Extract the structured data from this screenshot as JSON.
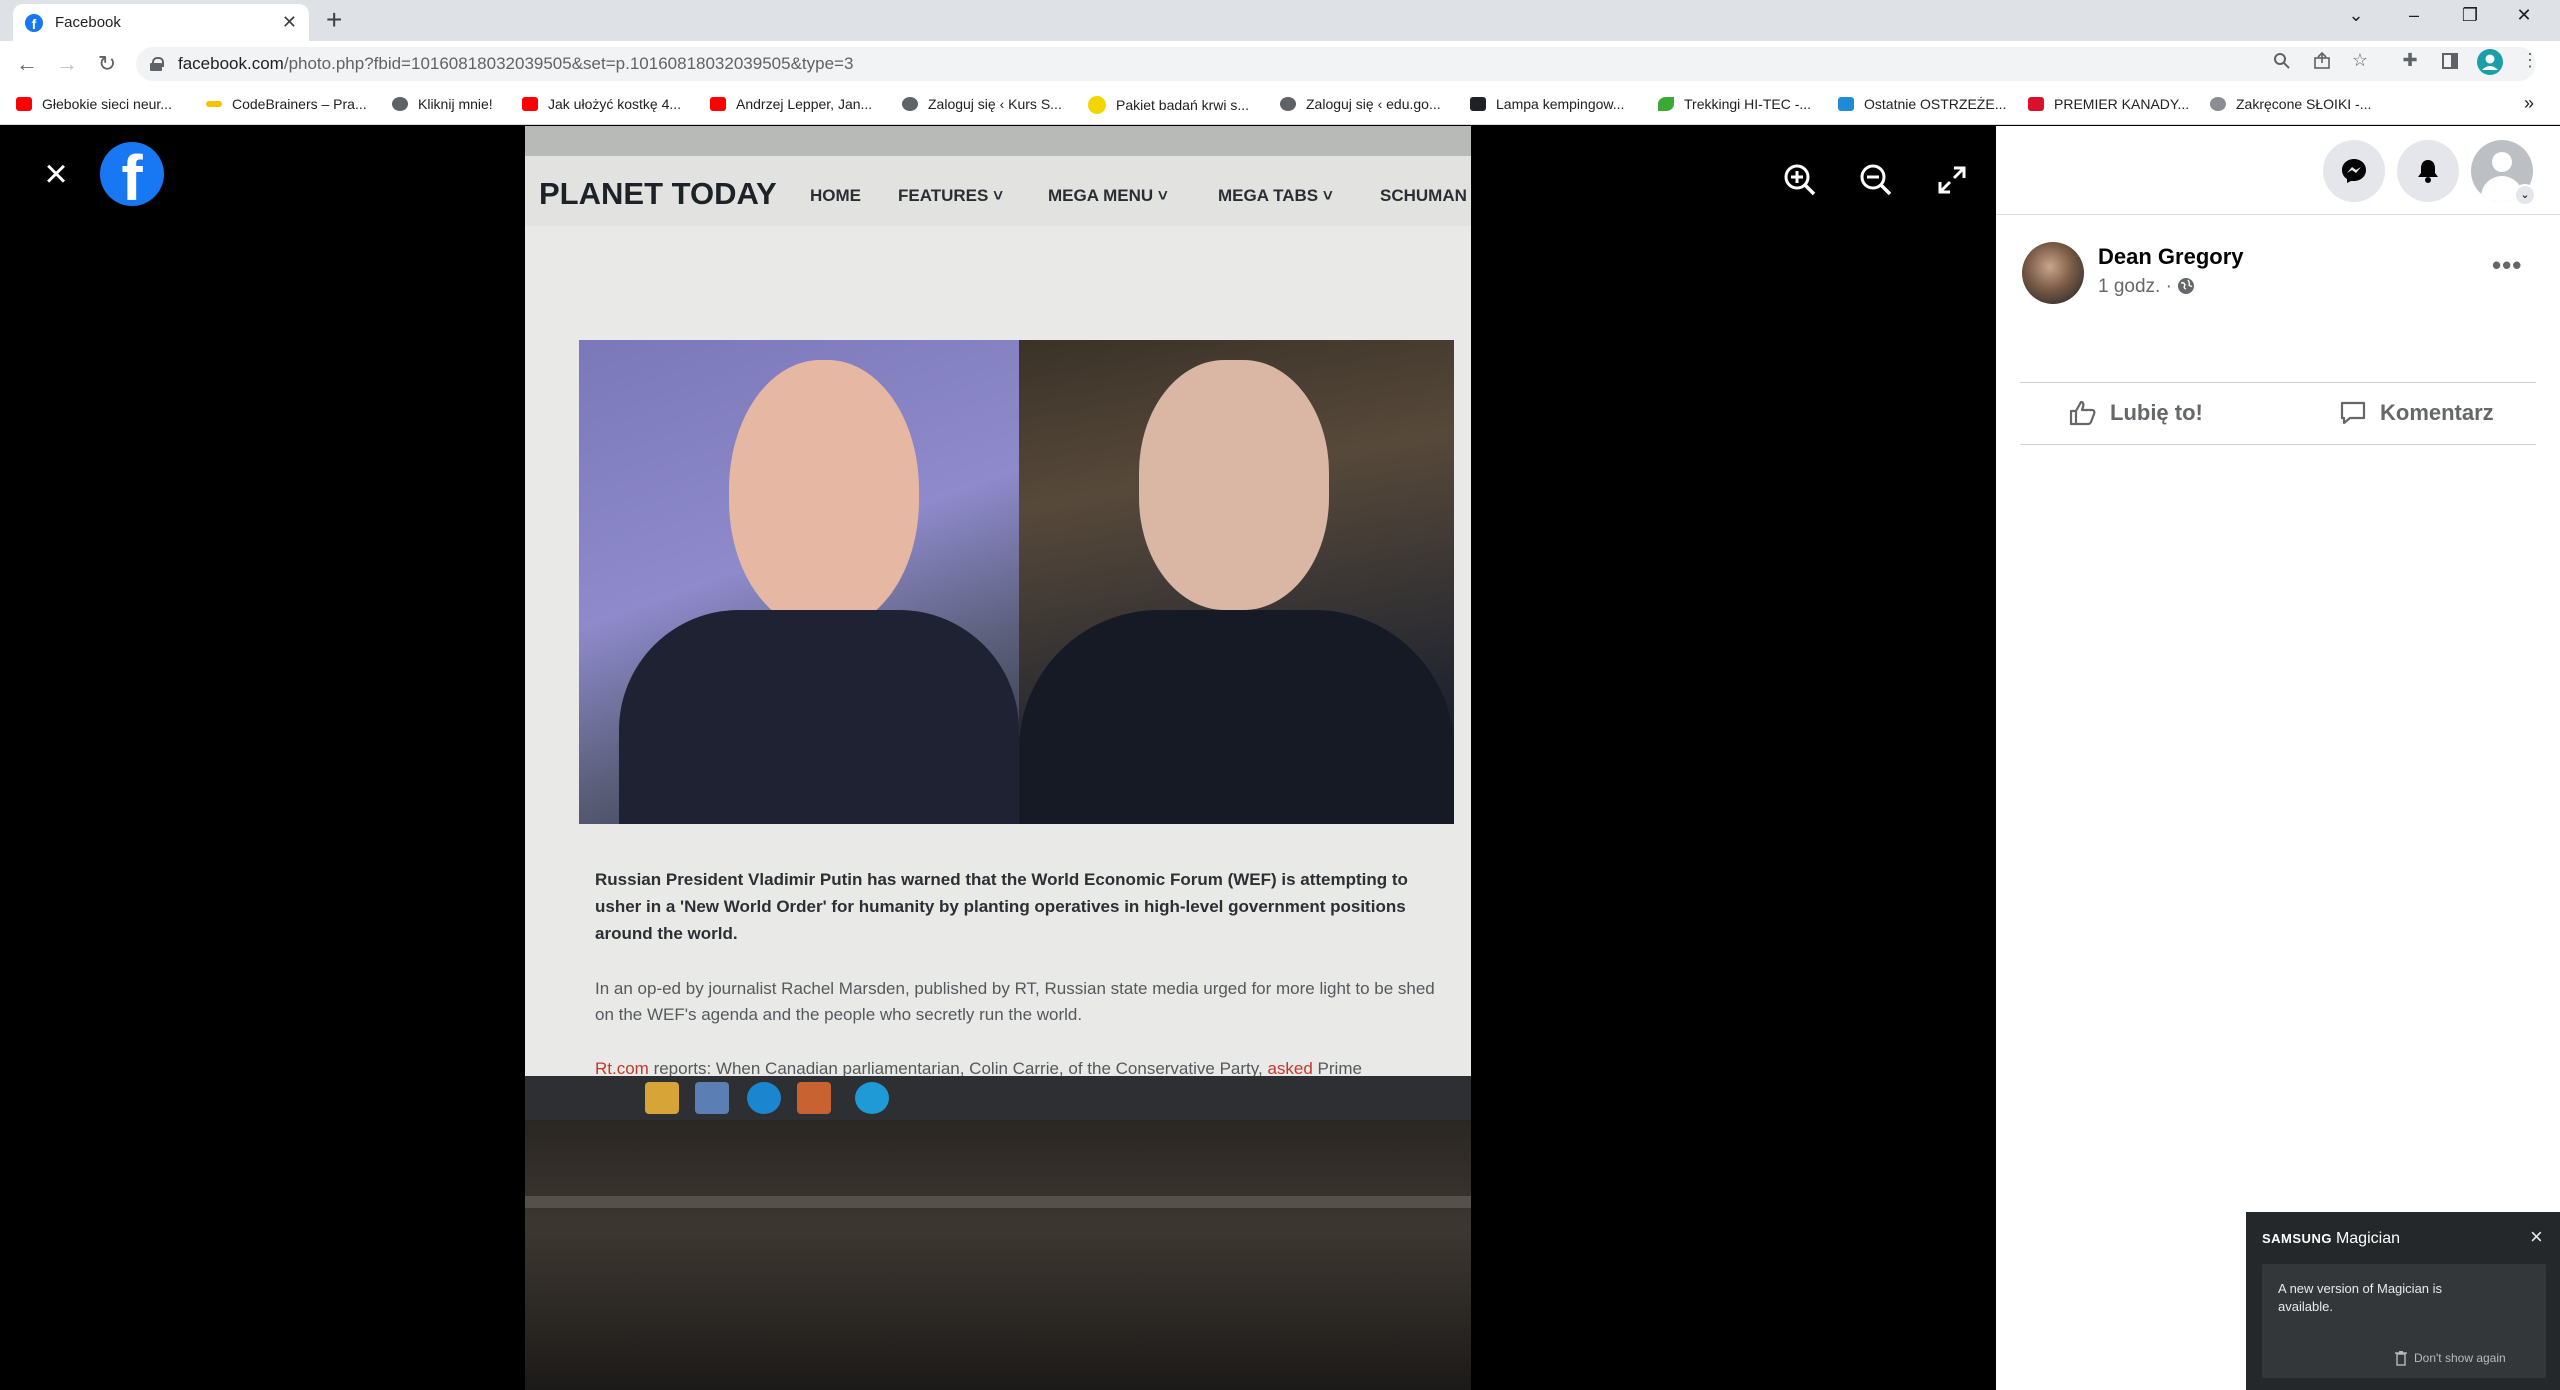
{
  "browser": {
    "tab_title": "Facebook",
    "tab_favicon": "f",
    "new_tab": "+",
    "url_domain": "facebook.com",
    "url_path": "/photo.php?fbid=10160818032039505&set=p.10160818032039505&type=3",
    "bookmarks": [
      {
        "label": "Głebokie sieci neur...",
        "icon_color": "#ff0000"
      },
      {
        "label": "CodeBrainers – Pra...",
        "icon_color": "#f5c400"
      },
      {
        "label": "Kliknij mnie!",
        "icon_color": "#5f6368"
      },
      {
        "label": "Jak ułożyć kostkę 4...",
        "icon_color": "#ff0000"
      },
      {
        "label": "Andrzej Lepper, Jan...",
        "icon_color": "#ff0000"
      },
      {
        "label": "Zaloguj się ‹ Kurs S...",
        "icon_color": "#5f6368"
      },
      {
        "label": "Pakiet badań krwi s...",
        "icon_color": "#f2d600"
      },
      {
        "label": "Zaloguj się ‹ edu.go...",
        "icon_color": "#5f6368"
      },
      {
        "label": "Lampa kempingow...",
        "icon_color": "#202124"
      },
      {
        "label": "Trekkingi HI-TEC -...",
        "icon_color": "#3aa935"
      },
      {
        "label": "Ostatnie OSTRZEŻE...",
        "icon_color": "#1f8ad6"
      },
      {
        "label": "PREMIER KANADY...",
        "icon_color": "#d8102a"
      },
      {
        "label": "Zakręcone SŁOIKI -...",
        "icon_color": "#8a8d91"
      }
    ],
    "bookmarks_overflow": "»"
  },
  "viewer": {
    "close_icon": "×",
    "logo_letter": "f"
  },
  "photo": {
    "site_logo": "PLANET TODAY",
    "menu": [
      "HOME",
      "FEATURES ˅",
      "MEGA MENU ˅",
      "MEGA TABS ˅",
      "SCHUMAN"
    ],
    "lead": "Russian President Vladimir Putin has warned that the World Economic Forum (WEF) is attempting to usher in a 'New World Order' for humanity by planting operatives in high-level government positions around the world.",
    "para": "In an op-ed by journalist Rachel Marsden, published by RT, Russian state media urged for more light to be shed on the WEF's agenda and the people who secretly run the world.",
    "para2_link": "Rt.com",
    "para2_text": " reports: When Canadian parliamentarian, Colin Carrie, of the Conservative Party, ",
    "para2_link2": "asked",
    "para2_tail": " Prime"
  },
  "post": {
    "author": "Dean Gregory",
    "time": "1 godz. ·",
    "more": "•••",
    "like_label": "Lubię to!",
    "comment_label": "Komentarz"
  },
  "popup": {
    "brand": "SAMSUNG",
    "title": "Magician",
    "close": "×",
    "message": "A new version of Magician is available.",
    "dont_show": "Don't show again"
  }
}
